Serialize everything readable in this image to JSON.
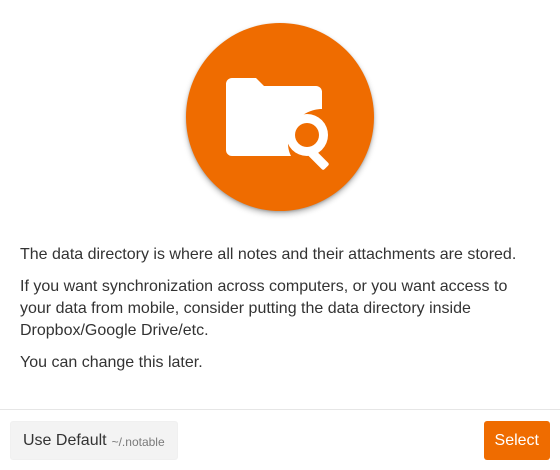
{
  "hero": {
    "icon": "folder-search-icon",
    "accent_color": "#ef6c00"
  },
  "content": {
    "paragraphs": [
      "The data directory is where all notes and their attachments are stored.",
      "If you want synchronization across computers, or you want access to your data from mobile, consider putting the data directory inside Dropbox/Google Drive/etc.",
      "You can change this later."
    ]
  },
  "footer": {
    "use_default_label": "Use Default",
    "default_path": "~/.notable",
    "select_label": "Select"
  }
}
